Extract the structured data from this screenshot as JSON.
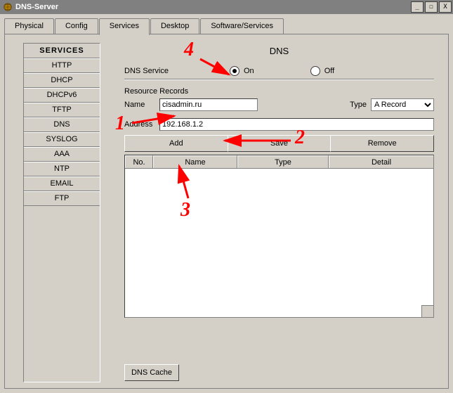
{
  "window": {
    "title": "DNS-Server"
  },
  "win_controls": {
    "min": "_",
    "max": "☐",
    "close": "X"
  },
  "tabs": [
    "Physical",
    "Config",
    "Services",
    "Desktop",
    "Software/Services"
  ],
  "active_tab": "Services",
  "sidebar": {
    "header": "SERVICES",
    "items": [
      "HTTP",
      "DHCP",
      "DHCPv6",
      "TFTP",
      "DNS",
      "SYSLOG",
      "AAA",
      "NTP",
      "EMAIL",
      "FTP"
    ]
  },
  "page": {
    "title": "DNS",
    "service_label": "DNS Service",
    "on_label": "On",
    "off_label": "Off",
    "service_on": true,
    "section_records": "Resource Records",
    "name_label": "Name",
    "name_value": "cisadmin.ru",
    "type_label": "Type",
    "type_value": "A Record",
    "address_label": "Address",
    "address_value": "192.168.1.2",
    "btn_add": "Add",
    "btn_save": "Save",
    "btn_remove": "Remove",
    "table_headers": {
      "no": "No.",
      "name": "Name",
      "type": "Type",
      "detail": "Detail"
    },
    "dns_cache": "DNS Cache"
  },
  "annotations": {
    "n1": "1",
    "n2": "2",
    "n3": "3",
    "n4": "4"
  }
}
